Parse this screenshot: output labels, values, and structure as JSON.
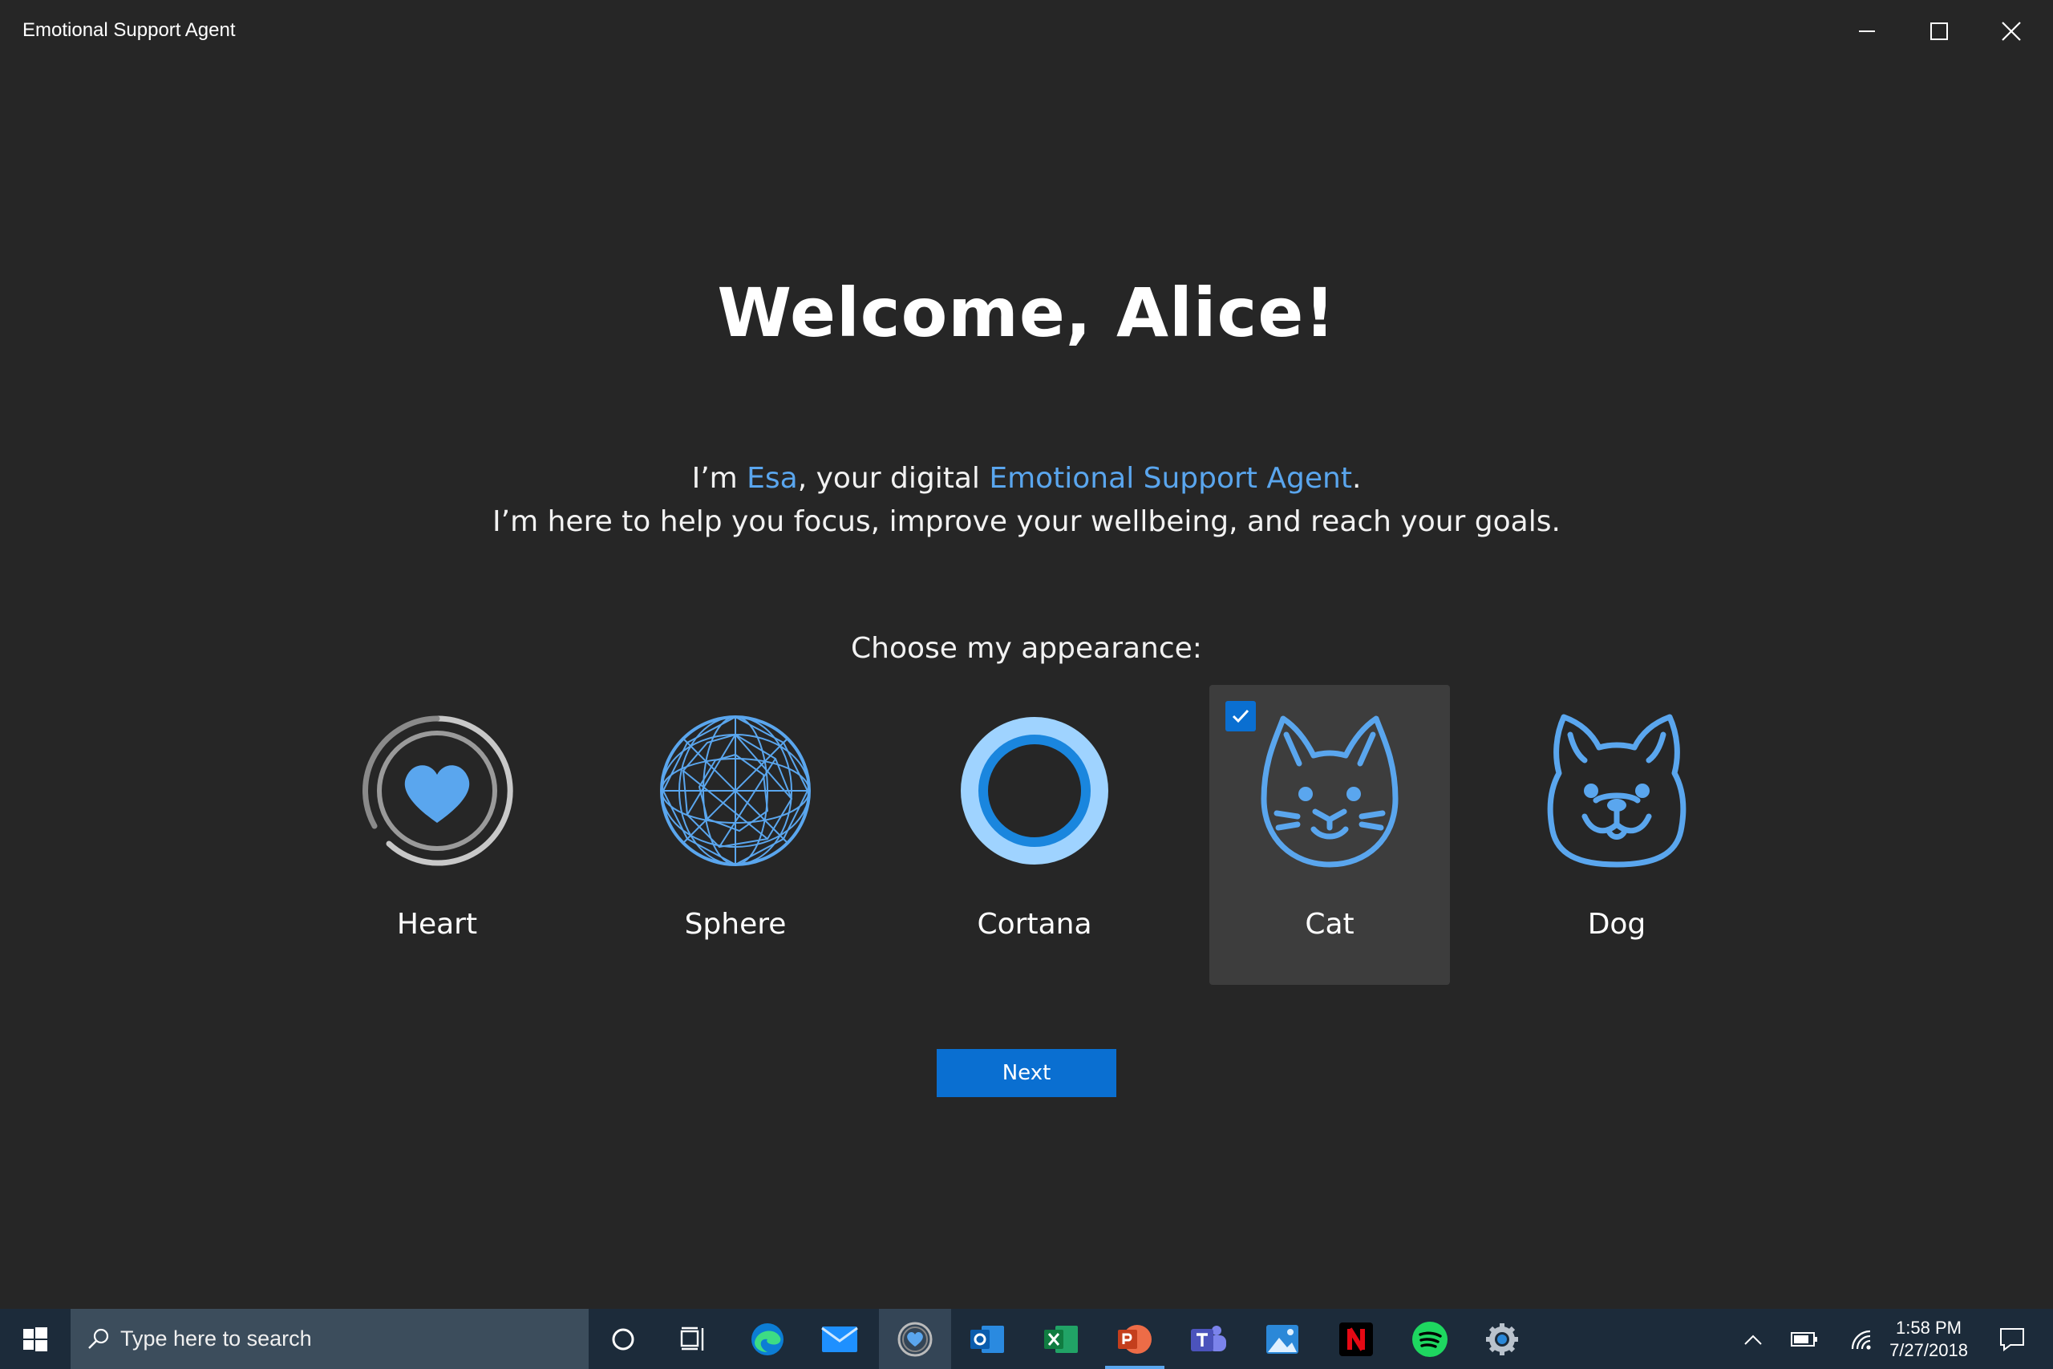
{
  "window": {
    "title": "Emotional Support Agent"
  },
  "welcome": {
    "heading": "Welcome, Alice!",
    "intro_prefix": "I’m ",
    "agent_name": "Esa",
    "intro_middle": ", your digital ",
    "agent_full": "Emotional Support Agent",
    "intro_suffix": ".",
    "intro_line2": "I’m here to help you focus, improve your wellbeing, and reach your goals."
  },
  "appearance": {
    "prompt": "Choose my appearance:",
    "options": [
      {
        "label": "Heart",
        "icon": "heart-ring-icon",
        "selected": false
      },
      {
        "label": "Sphere",
        "icon": "geodesic-sphere-icon",
        "selected": false
      },
      {
        "label": "Cortana",
        "icon": "cortana-ring-icon",
        "selected": false
      },
      {
        "label": "Cat",
        "icon": "cat-face-icon",
        "selected": true
      },
      {
        "label": "Dog",
        "icon": "dog-face-icon",
        "selected": false
      }
    ],
    "selected_index": 3
  },
  "actions": {
    "next_label": "Next"
  },
  "taskbar": {
    "search_placeholder": "Type here to search",
    "apps": [
      "cortana-icon",
      "task-view-icon",
      "edge-icon",
      "mail-icon",
      "esa-app-icon",
      "outlook-icon",
      "excel-icon",
      "powerpoint-icon",
      "teams-icon",
      "photos-icon",
      "netflix-icon",
      "spotify-icon",
      "settings-icon"
    ],
    "time": "1:58 PM",
    "date": "7/27/2018"
  },
  "colors": {
    "background": "#262626",
    "accent": "#0a6fd1",
    "highlight": "#5aa6ee",
    "selected_card": "#3d3d3d",
    "taskbar": "#1c2b3a"
  }
}
